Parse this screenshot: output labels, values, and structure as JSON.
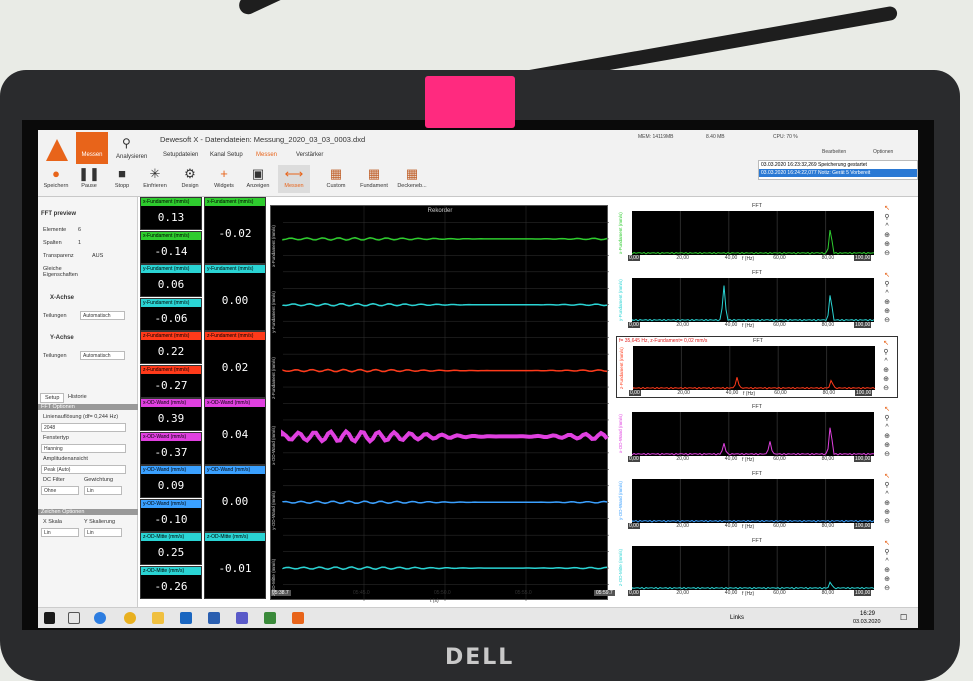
{
  "window": {
    "title": "Dewesoft X - Datendateien: Messung_2020_03_03_0003.dxd"
  },
  "ribbon": {
    "tabs": [
      {
        "label": "Messen"
      },
      {
        "label": "Analysieren"
      },
      {
        "label": "Setupdateien"
      },
      {
        "label": "Kanal Setup"
      },
      {
        "label": "Messen"
      },
      {
        "label": "Verstärker"
      }
    ],
    "tools": [
      {
        "label": "Speichern",
        "icon": "record-icon"
      },
      {
        "label": "Pause",
        "icon": "pause-icon"
      },
      {
        "label": "Stopp",
        "icon": "stop-icon"
      },
      {
        "label": "Einfrieren",
        "icon": "freeze-icon"
      },
      {
        "label": "Design",
        "icon": "gear-icon"
      },
      {
        "label": "Widgets",
        "icon": "plus-icon"
      },
      {
        "label": "Anzeigen",
        "icon": "display-icon"
      },
      {
        "label": "Messen",
        "icon": "measure-icon"
      },
      {
        "label": "Custom",
        "icon": "custom-icon"
      },
      {
        "label": "Fundament",
        "icon": "fundament-icon"
      },
      {
        "label": "Deckeneb...",
        "icon": "ceiling-icon"
      }
    ],
    "status": {
      "mem": "MEM: 14119MB",
      "disk": "8.40 MB",
      "cpu": "CPU: 70 %",
      "edit": "Bearbeiten",
      "options": "Optionen"
    },
    "log": [
      {
        "time": "03.03.2020 16:23:32,269",
        "msg": "Speicherung gestartet"
      },
      {
        "time": "03.03.2020 16:24:22,077",
        "msg": "Notiz: Gerät 5 Vorbereit"
      }
    ]
  },
  "left_panel": {
    "title": "FFT preview",
    "elemente_label": "Elemente",
    "elemente_value": "6",
    "spalten_label": "Spalten",
    "spalten_value": "1",
    "transparenz_label": "Transparenz",
    "transparenz_value": "AUS",
    "gleiche_label": "Gleiche Eigenschaften",
    "x_achse": "X-Achse",
    "y_achse": "Y-Achse",
    "teilungen_label": "Teilungen",
    "teilungen_value": "Automatisch",
    "tab_setup": "Setup",
    "tab_historie": "Historie",
    "fft_optionen": "FFT Optionen",
    "linien_label": "Linienauflösung (df= 0,244 Hz)",
    "linien_value": "2048",
    "fenster_label": "Fenstertyp",
    "fenster_value": "Hanning",
    "amplitude_label": "Amplitudenansicht",
    "amplitude_value": "Peak (Auto)",
    "dc_label": "DC Filter",
    "dc_value": "Ohne",
    "gewichtung_label": "Gewichtung",
    "gewichtung_value": "Lin",
    "zeichen_label": "Zeichen Optionen",
    "xskala_label": "X Skala",
    "xskala_value": "Lin",
    "yskala_label": "Y Skalierung",
    "yskala_value": "Lin"
  },
  "channels": [
    {
      "name": "x-Fundament (mm/s)",
      "color": "#2ecc2e",
      "max": "0.13",
      "min": "-0.14",
      "mean": "-0.02"
    },
    {
      "name": "y-Fundament (mm/s)",
      "color": "#2ad4d4",
      "max": "0.06",
      "min": "-0.06",
      "mean": "0.00"
    },
    {
      "name": "z-Fundament (mm/s)",
      "color": "#ff3a1a",
      "max": "0.22",
      "min": "-0.27",
      "mean": "0.02"
    },
    {
      "name": "x-OD-Wand (mm/s)",
      "color": "#e040e0",
      "max": "0.39",
      "min": "-0.37",
      "mean": "0.04"
    },
    {
      "name": "y-OD-Wand (mm/s)",
      "color": "#3aa0ff",
      "max": "0.09",
      "min": "-0.10",
      "mean": "0.00"
    },
    {
      "name": "z-OD-Mitte (mm/s)",
      "color": "#2ad4d4",
      "max": "0.25",
      "min": "-0.26",
      "mean": "-0.01"
    }
  ],
  "recorder": {
    "title": "Rekorder",
    "ylabels": [
      "x-Fundament (mm/s)",
      "y-Fundament (mm/s)",
      "z-Fundament (mm/s)",
      "x-OD-Wand (mm/s)",
      "y-OD-Wand (mm/s)",
      "z-OD-Mitte (mm/s)"
    ],
    "xticks": [
      "05:38.7",
      "05:45.0",
      "05:50.0",
      "05:55.0",
      "05:59.7"
    ],
    "xlabel": "t (s)"
  },
  "fft_panels": [
    {
      "title": "FFT",
      "ylabel": "x-Fundament (mm/s)",
      "color": "#2ecc2e",
      "cursor": ""
    },
    {
      "title": "FFT",
      "ylabel": "y-Fundament (mm/s)",
      "color": "#2ad4d4",
      "cursor": ""
    },
    {
      "title": "FFT",
      "ylabel": "z-Fundament (mm/s)",
      "color": "#ff3a1a",
      "cursor": "f= 35,645 Hz, z-Fundament= 0,02 mm/s"
    },
    {
      "title": "FFT",
      "ylabel": "x-OD-Wand (mm/s)",
      "color": "#e040e0",
      "cursor": ""
    },
    {
      "title": "FFT",
      "ylabel": "y-OD-Wand (mm/s)",
      "color": "#3aa0ff",
      "cursor": ""
    },
    {
      "title": "FFT",
      "ylabel": "z-OD-Mitte (mm/s)",
      "color": "#2ad4d4",
      "cursor": ""
    }
  ],
  "fft_axis": {
    "ticks": [
      "0,00",
      "20,00",
      "40,00",
      "60,00",
      "80,00",
      "100,00"
    ],
    "xlabel": "f (Hz)"
  },
  "taskbar": {
    "links": "Links",
    "time": "16:29",
    "date": "03.03.2020"
  }
}
